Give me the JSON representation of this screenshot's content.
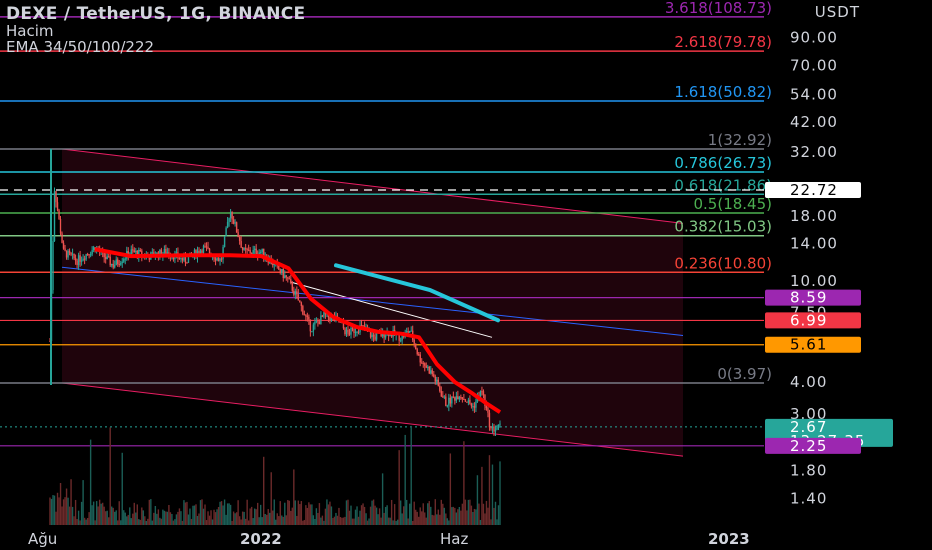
{
  "header": {
    "title": "DEXE / TetherUS, 1G, BINANCE",
    "indicator_volume": "Hacim",
    "indicator_ema": "EMA 34/50/100/222"
  },
  "axis": {
    "currency": "USDT"
  },
  "chart_data": {
    "type": "candlestick",
    "title": "DEXE / TetherUS, 1G, BINANCE",
    "y_scale": "log",
    "y_ticks": [
      "90.00",
      "70.00",
      "54.00",
      "42.00",
      "32.00",
      "18.00",
      "14.00",
      "10.00",
      "7.50",
      "4.00",
      "3.00",
      "2.25",
      "1.80",
      "1.40"
    ],
    "x_ticks": [
      {
        "label": "Ağu",
        "bold": false
      },
      {
        "label": "2022",
        "bold": true
      },
      {
        "label": "Haz",
        "bold": false
      },
      {
        "label": "2023",
        "bold": true
      }
    ],
    "fib_levels": [
      {
        "label": "3.618(108.73)",
        "value": 108.73,
        "color": "#9c27b0"
      },
      {
        "label": "2.618(79.78)",
        "value": 79.78,
        "color": "#f23645"
      },
      {
        "label": "1.618(50.82)",
        "value": 50.82,
        "color": "#2196f3"
      },
      {
        "label": "1(32.92)",
        "value": 32.92,
        "color": "#787b86"
      },
      {
        "label": "0.786(26.73)",
        "value": 26.73,
        "color": "#26c6da"
      },
      {
        "label": "0.618(21.86)",
        "value": 21.86,
        "color": "#26a69a"
      },
      {
        "label": "0.5(18.45)",
        "value": 18.45,
        "color": "#4caf50"
      },
      {
        "label": "0.382(15.03)",
        "value": 15.03,
        "color": "#81c784"
      },
      {
        "label": "0.236(10.80)",
        "value": 10.8,
        "color": "#f44336"
      },
      {
        "label": "0(3.97)",
        "value": 3.97,
        "color": "#787b86"
      }
    ],
    "extra_levels": [
      {
        "value": 8.59,
        "color": "#9c27b0"
      },
      {
        "value": 6.99,
        "color": "#f23645"
      },
      {
        "value": 5.61,
        "color": "#ff9800"
      },
      {
        "value": 2.25,
        "color": "#9c27b0"
      }
    ],
    "price_badges": [
      {
        "text": "22.72",
        "value": 22.72,
        "bg": "#ffffff",
        "fg": "#000000"
      },
      {
        "text": "8.59",
        "value": 8.59,
        "bg": "#9c27b0",
        "fg": "#ffffff"
      },
      {
        "text": "6.99",
        "value": 6.99,
        "bg": "#f23645",
        "fg": "#ffffff"
      },
      {
        "text": "5.61",
        "value": 5.61,
        "bg": "#ff9800",
        "fg": "#000000"
      },
      {
        "text": "2.67",
        "value": 2.67,
        "bg": "#26a69a",
        "fg": "#ffffff",
        "sub": "13:27:35"
      },
      {
        "text": "2.25",
        "value": 2.25,
        "bg": "#9c27b0",
        "fg": "#ffffff"
      }
    ],
    "last_price": 2.67,
    "countdown": "13:27:35",
    "dashed_level": 22.72,
    "candle_path_points": [
      [
        0,
        5.8
      ],
      [
        0.01,
        23
      ],
      [
        0.03,
        13
      ],
      [
        0.06,
        12
      ],
      [
        0.1,
        13.5
      ],
      [
        0.14,
        11.5
      ],
      [
        0.18,
        13
      ],
      [
        0.22,
        12.5
      ],
      [
        0.26,
        13
      ],
      [
        0.3,
        12
      ],
      [
        0.34,
        13.5
      ],
      [
        0.38,
        12
      ],
      [
        0.4,
        19
      ],
      [
        0.43,
        13
      ],
      [
        0.47,
        13
      ],
      [
        0.5,
        11.5
      ],
      [
        0.53,
        10
      ],
      [
        0.55,
        8.5
      ],
      [
        0.58,
        6.5
      ],
      [
        0.61,
        7.3
      ],
      [
        0.64,
        7.0
      ],
      [
        0.66,
        6.2
      ],
      [
        0.69,
        6.6
      ],
      [
        0.72,
        6.0
      ],
      [
        0.75,
        6.3
      ],
      [
        0.78,
        6.0
      ],
      [
        0.8,
        6.4
      ],
      [
        0.82,
        5.0
      ],
      [
        0.85,
        4.3
      ],
      [
        0.88,
        3.3
      ],
      [
        0.91,
        3.6
      ],
      [
        0.94,
        3.2
      ],
      [
        0.96,
        3.7
      ],
      [
        0.98,
        2.6
      ],
      [
        1.0,
        2.67
      ]
    ],
    "ema_points": [
      [
        0.1,
        13.3
      ],
      [
        0.18,
        12.5
      ],
      [
        0.3,
        12.6
      ],
      [
        0.4,
        12.6
      ],
      [
        0.47,
        12.5
      ],
      [
        0.53,
        11.2
      ],
      [
        0.58,
        8.5
      ],
      [
        0.63,
        7.2
      ],
      [
        0.68,
        6.6
      ],
      [
        0.73,
        6.3
      ],
      [
        0.78,
        6.2
      ],
      [
        0.82,
        6.0
      ],
      [
        0.86,
        4.7
      ],
      [
        0.9,
        4.0
      ],
      [
        0.94,
        3.6
      ],
      [
        0.97,
        3.3
      ],
      [
        1.0,
        3.05
      ]
    ],
    "ema_long_points": [
      [
        0.0,
        10.2
      ],
      [
        0.15,
        9.1
      ],
      [
        0.3,
        8.3
      ],
      [
        0.4,
        7.6
      ],
      [
        0.48,
        7.0
      ]
    ],
    "channel": {
      "top_start": 32.92,
      "top_end": 16.8,
      "bottom_start": 3.97,
      "bottom_end": 2.05,
      "mid_start": 11.3,
      "mid_end": 6.1
    }
  }
}
